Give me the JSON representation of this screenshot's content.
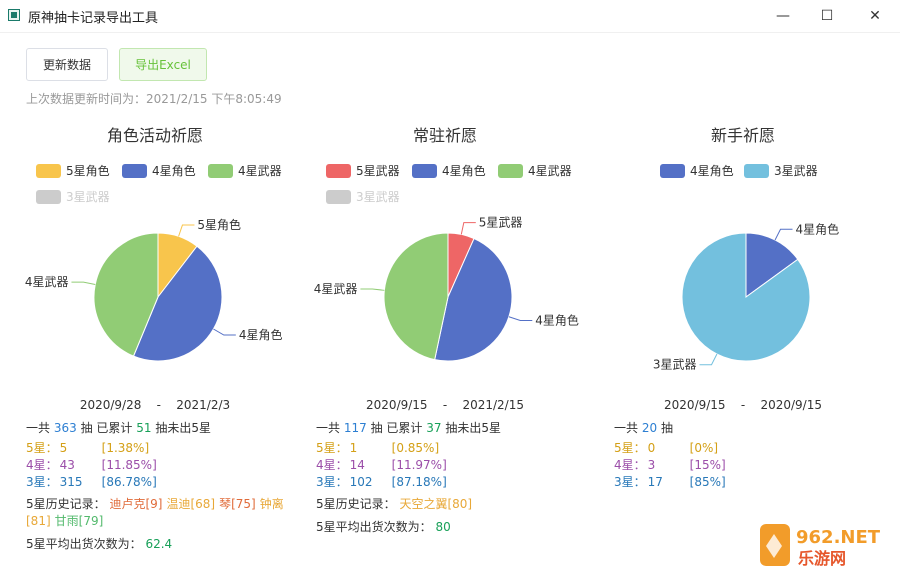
{
  "window": {
    "title": "原神抽卡记录导出工具",
    "controls": {
      "minimize": "—",
      "maximize": "☐",
      "close": "✕"
    }
  },
  "toolbar": {
    "update_label": "更新数据",
    "export_label": "导出Excel"
  },
  "update_time": "上次数据更新时间为：2021/2/15 下午8:05:49",
  "colors": {
    "star5_char": "#f8c54c",
    "star4_char": "#5470c6",
    "star4_weapon": "#91cc75",
    "star3_weapon": "#73c0de",
    "star5_weapon": "#ee6666",
    "inactive": "#cccccc"
  },
  "panels": [
    {
      "title": "角色活动祈愿",
      "legend": [
        {
          "label": "5星角色",
          "color": "#f8c54c",
          "active": true
        },
        {
          "label": "4星角色",
          "color": "#5470c6",
          "active": true
        },
        {
          "label": "4星武器",
          "color": "#91cc75",
          "active": true
        },
        {
          "label": "3星武器",
          "color": "#cccccc",
          "active": false
        }
      ],
      "date_start": "2020/9/28",
      "date_sep": "-",
      "date_end": "2021/2/3",
      "total_label": "一共",
      "total": "363",
      "pull_unit": "抽",
      "since_label": "已累计",
      "since": "51",
      "since_suffix": "抽未出5星",
      "stars": [
        {
          "label": "5星：",
          "count": "5",
          "pct": "[1.38%]"
        },
        {
          "label": "4星：",
          "count": "43",
          "pct": "[11.85%]"
        },
        {
          "label": "3星：",
          "count": "315",
          "pct": "[86.78%]"
        }
      ],
      "history_label": "5星历史记录：",
      "history": [
        {
          "text": "迪卢克[9]",
          "color": "#e06b3a"
        },
        {
          "text": "温迪[68]",
          "color": "#e8a838"
        },
        {
          "text": "琴[75]",
          "color": "#e06b3a"
        },
        {
          "text": "钟离[81]",
          "color": "#e8a838"
        },
        {
          "text": "甘雨[79]",
          "color": "#52b96c"
        }
      ],
      "avg_label": "5星平均出货次数为：",
      "avg": "62.4",
      "chart_data": {
        "type": "pie",
        "title": "角色活动祈愿",
        "labels": [
          "5星角色",
          "4星角色",
          "4星武器"
        ],
        "values": [
          5,
          22,
          21
        ],
        "colors": [
          "#f8c54c",
          "#5470c6",
          "#91cc75"
        ],
        "hidden": [
          "3星武器"
        ]
      }
    },
    {
      "title": "常驻祈愿",
      "legend": [
        {
          "label": "5星武器",
          "color": "#ee6666",
          "active": true
        },
        {
          "label": "4星角色",
          "color": "#5470c6",
          "active": true
        },
        {
          "label": "4星武器",
          "color": "#91cc75",
          "active": true
        },
        {
          "label": "3星武器",
          "color": "#cccccc",
          "active": false
        }
      ],
      "date_start": "2020/9/15",
      "date_sep": "-",
      "date_end": "2021/2/15",
      "total_label": "一共",
      "total": "117",
      "pull_unit": "抽",
      "since_label": "已累计",
      "since": "37",
      "since_suffix": "抽未出5星",
      "stars": [
        {
          "label": "5星：",
          "count": "1",
          "pct": "[0.85%]"
        },
        {
          "label": "4星：",
          "count": "14",
          "pct": "[11.97%]"
        },
        {
          "label": "3星：",
          "count": "102",
          "pct": "[87.18%]"
        }
      ],
      "history_label": "5星历史记录：",
      "history": [
        {
          "text": "天空之翼[80]",
          "color": "#e8a838"
        }
      ],
      "avg_label": "5星平均出货次数为：",
      "avg": "80",
      "chart_data": {
        "type": "pie",
        "title": "常驻祈愿",
        "labels": [
          "5星武器",
          "4星角色",
          "4星武器"
        ],
        "values": [
          1,
          7,
          7
        ],
        "colors": [
          "#ee6666",
          "#5470c6",
          "#91cc75"
        ],
        "hidden": [
          "3星武器"
        ]
      }
    },
    {
      "title": "新手祈愿",
      "legend": [
        {
          "label": "4星角色",
          "color": "#5470c6",
          "active": true
        },
        {
          "label": "3星武器",
          "color": "#73c0de",
          "active": true
        }
      ],
      "date_start": "2020/9/15",
      "date_sep": "-",
      "date_end": "2020/9/15",
      "total_label": "一共",
      "total": "20",
      "pull_unit": "抽",
      "stars": [
        {
          "label": "5星：",
          "count": "0",
          "pct": "[0%]"
        },
        {
          "label": "4星：",
          "count": "3",
          "pct": "[15%]"
        },
        {
          "label": "3星：",
          "count": "17",
          "pct": "[85%]"
        }
      ],
      "chart_data": {
        "type": "pie",
        "title": "新手祈愿",
        "labels": [
          "4星角色",
          "3星武器"
        ],
        "values": [
          3,
          17
        ],
        "colors": [
          "#5470c6",
          "#73c0de"
        ]
      }
    }
  ],
  "watermark": {
    "line1": "962.NET",
    "line2": "乐游网"
  }
}
